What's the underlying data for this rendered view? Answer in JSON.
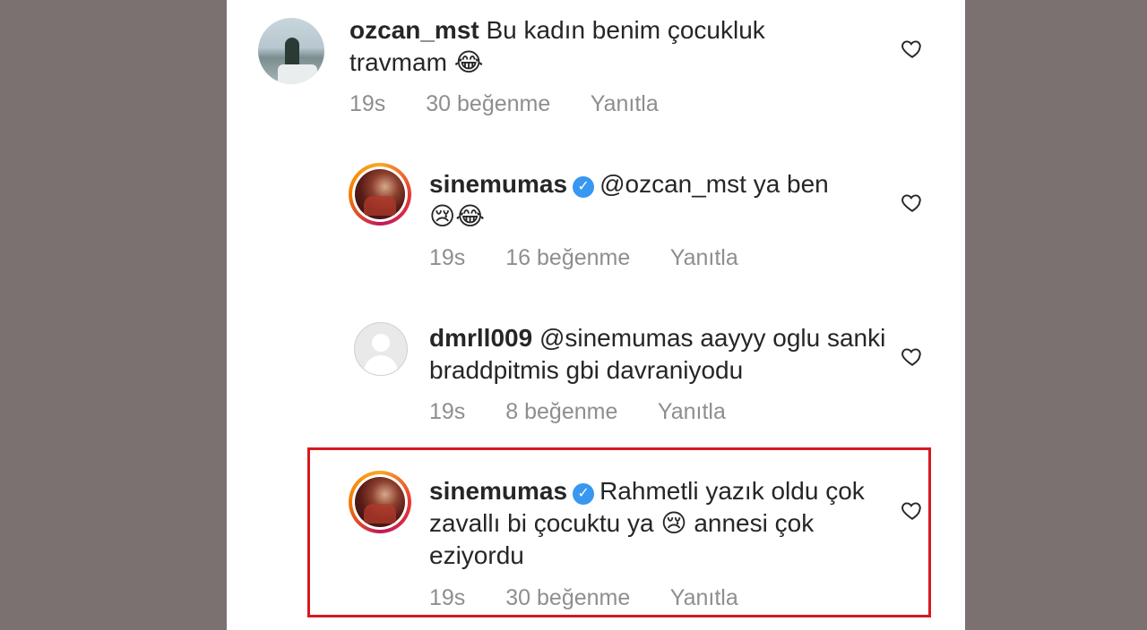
{
  "comments": [
    {
      "username": "ozcan_mst",
      "verified": false,
      "text": "Bu kadın benim çocukluk travmam",
      "emoji": "😂",
      "time": "19s",
      "likes": "30 beğenme",
      "reply": "Yanıtla",
      "avatar": "lake-photo-avatar"
    },
    {
      "username": "sinemumas",
      "verified": true,
      "mention": "@ozcan_mst",
      "text": "ya ben",
      "emoji": "😢😂",
      "time": "19s",
      "likes": "16 beğenme",
      "reply": "Yanıtla",
      "avatar": "story-ring-avatar"
    },
    {
      "username": "dmrll009",
      "verified": false,
      "mention": "@sinemumas",
      "text": "aayyy oglu sanki braddpitmis gbi davraniyodu",
      "time": "19s",
      "likes": "8 beğenme",
      "reply": "Yanıtla",
      "avatar": "default-avatar"
    },
    {
      "username": "sinemumas",
      "verified": true,
      "text_before": "Rahmetli yazık oldu çok zavallı bi çocuktu ya",
      "emoji": "😢",
      "text_after": "annesi çok eziyordu",
      "time": "19s",
      "likes": "30 beğenme",
      "reply": "Yanıtla",
      "avatar": "story-ring-avatar",
      "highlighted": true
    }
  ],
  "colors": {
    "background": "#7a7170",
    "panel": "#ffffff",
    "text": "#262626",
    "meta": "#8e8e8e",
    "verified": "#3897f0",
    "highlight": "#d71920"
  },
  "icons": {
    "like": "heart-outline-icon",
    "verified": "verified-badge-icon"
  }
}
